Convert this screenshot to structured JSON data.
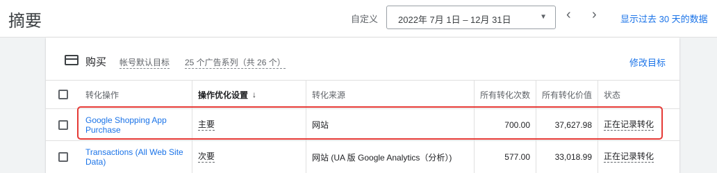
{
  "header": {
    "title": "摘要",
    "custom_label": "自定义",
    "date_range": "2022年 7月 1日 – 12月 31日",
    "prev_icon": "chevron-left-icon",
    "next_icon": "chevron-right-icon",
    "show_past_link": "显示过去 30 天的数据"
  },
  "card": {
    "icon": "purchase-icon",
    "title": "购买",
    "goal_type": "帐号默认目标",
    "campaigns": "25 个广告系列（共 26 个）",
    "edit_link": "修改目标"
  },
  "table": {
    "columns": [
      "转化操作",
      "操作优化设置",
      "转化来源",
      "所有转化次数",
      "所有转化价值",
      "状态"
    ],
    "sort_icon": "arrow-down-icon",
    "rows": [
      {
        "name": "Google Shopping App Purchase",
        "optimization": "主要",
        "source": "网站",
        "conversions": "700.00",
        "value": "37,627.98",
        "status": "正在记录转化"
      },
      {
        "name": "Transactions (All Web Site Data)",
        "optimization": "次要",
        "source": "网站 (UA 版 Google Analytics（分析）)",
        "conversions": "577.00",
        "value": "33,018.99",
        "status": "正在记录转化"
      }
    ]
  },
  "colors": {
    "accent": "#1a73e8",
    "highlight": "#e53935"
  }
}
